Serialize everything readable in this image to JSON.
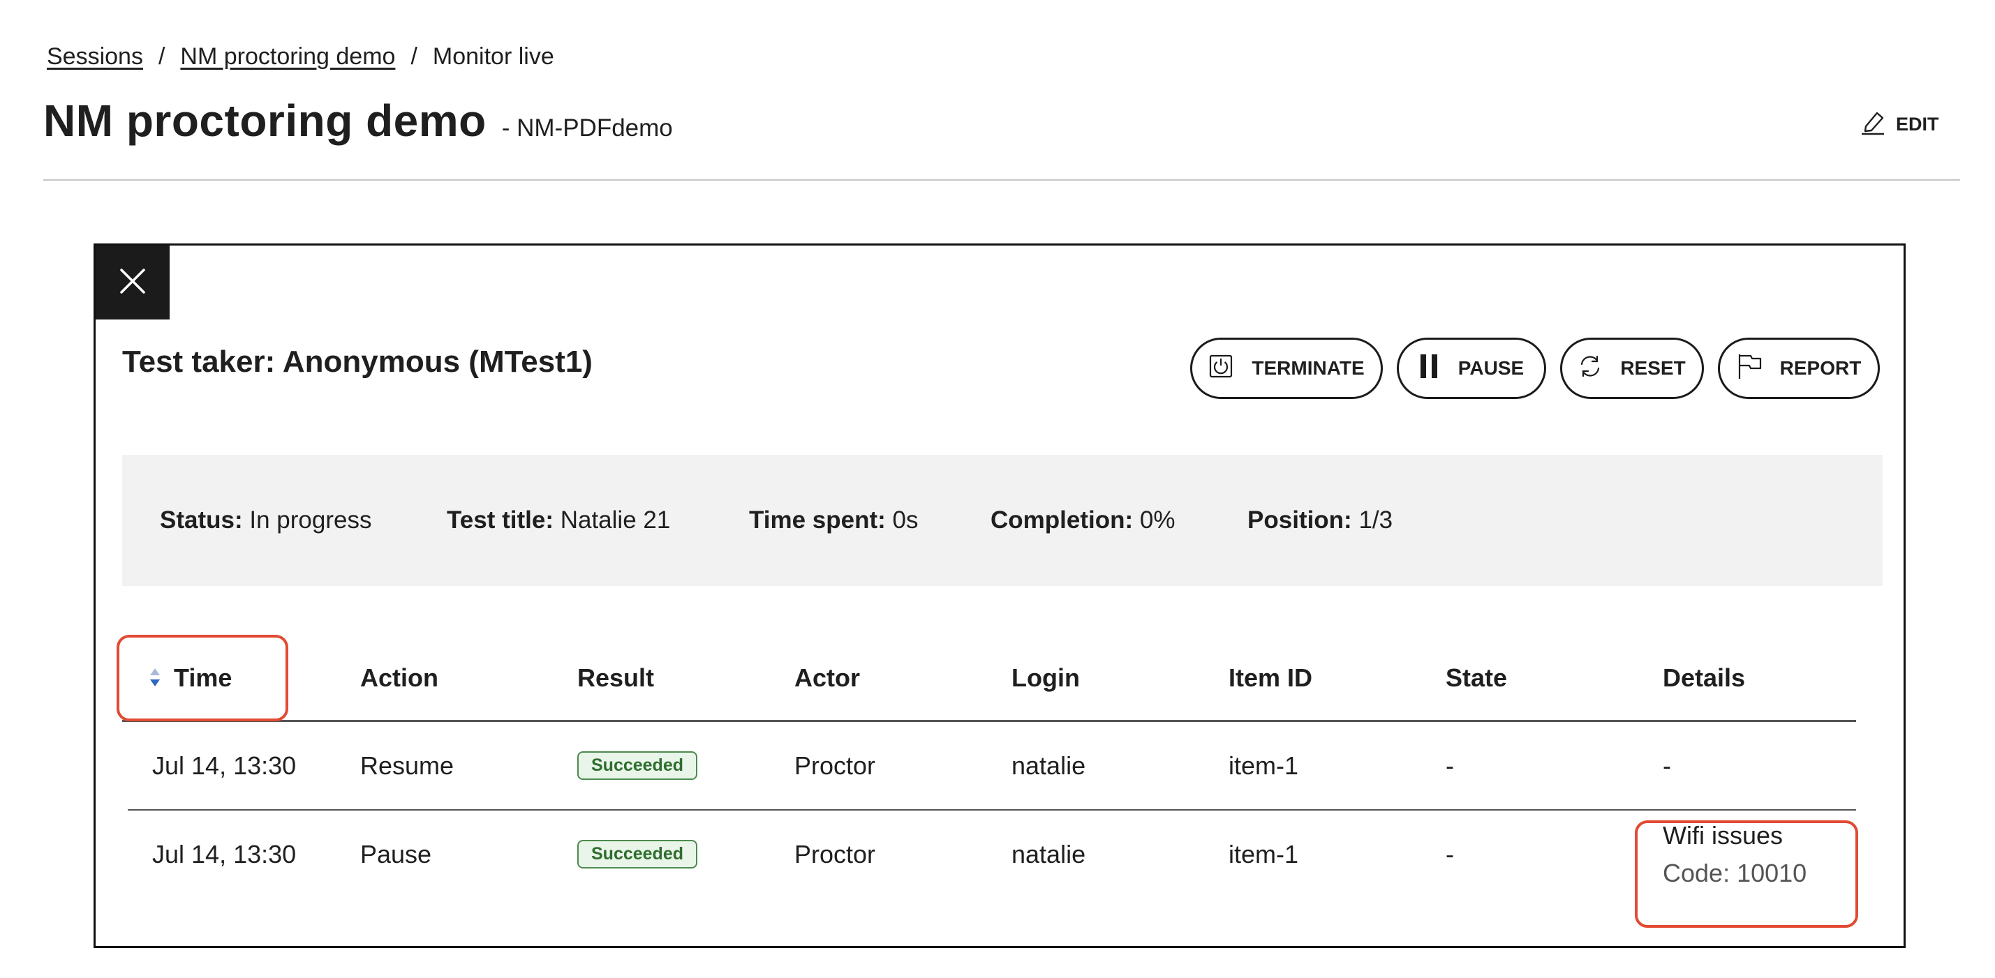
{
  "breadcrumb": {
    "items": [
      {
        "label": "Sessions",
        "link": true
      },
      {
        "label": "NM proctoring demo",
        "link": true
      },
      {
        "label": "Monitor live",
        "link": false
      }
    ],
    "separator": "/"
  },
  "header": {
    "title": "NM proctoring demo",
    "subtitle": "- NM-PDFdemo",
    "edit_label": "EDIT"
  },
  "panel": {
    "test_taker": "Test taker: Anonymous (MTest1)",
    "actions": {
      "terminate": "TERMINATE",
      "pause": "PAUSE",
      "reset": "RESET",
      "report": "REPORT"
    },
    "info": {
      "status_label": "Status:",
      "status_value": "In progress",
      "title_label": "Test title:",
      "title_value": "Natalie 21",
      "time_label": "Time spent:",
      "time_value": "0s",
      "completion_label": "Completion:",
      "completion_value": "0%",
      "position_label": "Position:",
      "position_value": "1/3"
    },
    "table": {
      "columns": [
        "Time",
        "Action",
        "Result",
        "Actor",
        "Login",
        "Item ID",
        "State",
        "Details"
      ],
      "rows": [
        {
          "time": "Jul 14, 13:30",
          "action": "Resume",
          "result": "Succeeded",
          "actor": "Proctor",
          "login": "natalie",
          "item_id": "item-1",
          "state": "-",
          "details": "-",
          "details_code": ""
        },
        {
          "time": "Jul 14, 13:30",
          "action": "Pause",
          "result": "Succeeded",
          "actor": "Proctor",
          "login": "natalie",
          "item_id": "item-1",
          "state": "-",
          "details": "Wifi issues",
          "details_code": "Code: 10010"
        }
      ]
    }
  },
  "colors": {
    "highlight": "#e24a33",
    "badge_green": "#2e6e2e",
    "close_bg": "#1b1b1b",
    "sort_up": "#a9b9d6",
    "sort_down": "#2f67c2"
  },
  "icons": {
    "edit": "pencil-icon",
    "close": "close-icon",
    "terminate": "power-icon",
    "pause": "pause-icon",
    "reset": "refresh-icon",
    "report": "flag-icon",
    "sort": "sort-icon"
  }
}
